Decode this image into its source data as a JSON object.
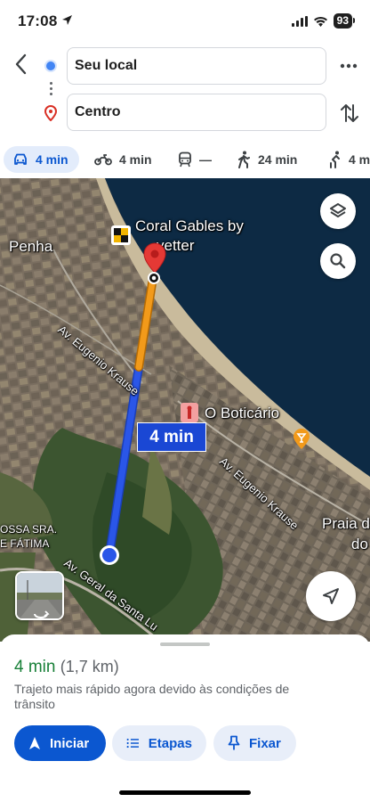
{
  "status_bar": {
    "time": "17:08",
    "battery": "93"
  },
  "route": {
    "origin": "Seu local",
    "destination": "Centro"
  },
  "modes": [
    {
      "id": "car",
      "label": "4 min",
      "active": true
    },
    {
      "id": "motorcycle",
      "label": "4 min",
      "active": false
    },
    {
      "id": "transit",
      "label": "—",
      "active": false
    },
    {
      "id": "walk",
      "label": "24 min",
      "active": false
    },
    {
      "id": "bike",
      "label": "4 m",
      "active": false
    }
  ],
  "map": {
    "labels": {
      "penha": "Penha",
      "coral_gables_1": "Coral Gables by",
      "coral_gables_2": "vetter",
      "boticario": "O Boticário",
      "av_eugenio_1": "Av. Eugenio Krause",
      "av_eugenio_2": "Av. Eugenio Krause",
      "nossa_sra_1": "OSSA SRA.",
      "nossa_sra_2": "E FÁTIMA",
      "av_geral": "Av. Geral da Santa Lu",
      "praia_1": "Praia d",
      "praia_2": "do"
    },
    "duration_chip": "4 min",
    "colors": {
      "route_blue": "#2a56e8",
      "route_orange": "#f29a1a",
      "pin_red": "#e53935",
      "sea": "#0d2a44"
    }
  },
  "sheet": {
    "duration": "4 min",
    "distance": "(1,7 km)",
    "description": "Trajeto mais rápido agora devido às condições de trânsito",
    "buttons": {
      "start": "Iniciar",
      "steps": "Etapas",
      "pin": "Fixar"
    }
  }
}
